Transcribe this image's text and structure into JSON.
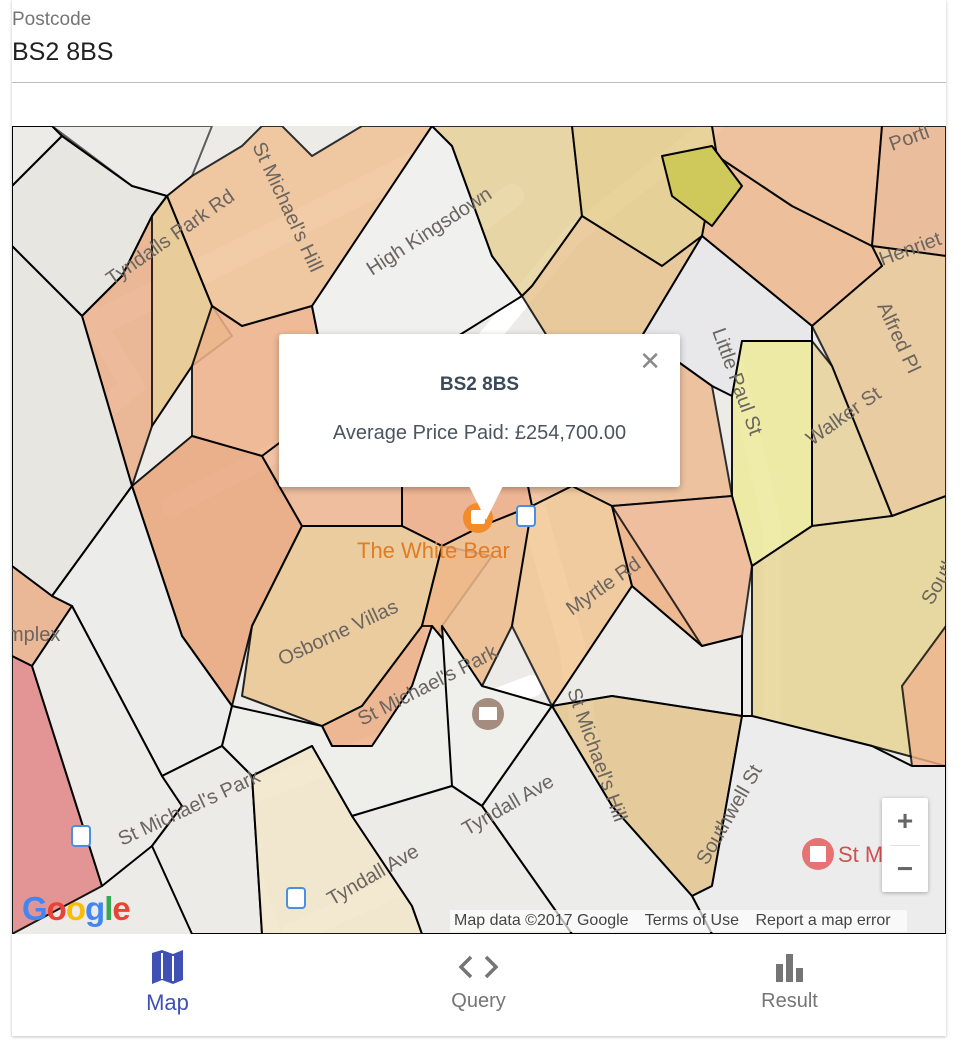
{
  "postcode_field": {
    "label": "Postcode",
    "value": "BS2 8BS"
  },
  "map": {
    "street_labels": [
      "Tyndalls Park Rd",
      "St Michael's Hill",
      "High Kingsdown",
      "Little Paul St",
      "Walker St",
      "Alfred Pl",
      "Portl",
      "Henriet",
      "Myrtle Rd",
      "Osborne Villas",
      "St Michael's Park",
      "St Michael's Park",
      "Tyndall Ave",
      "Tyndall Ave",
      "St Michael's Hill",
      "Southwell St",
      "South",
      "mplex"
    ],
    "poi_label": "The White Bear",
    "hospital_label": "St M",
    "popup": {
      "title": "BS2 8BS",
      "text": "Average Price Paid: £254,700.00",
      "close_icon": "close-icon"
    },
    "zoom_in_label": "+",
    "zoom_out_label": "−",
    "attribution": {
      "map_data": "Map data ©2017 Google",
      "terms": "Terms of Use",
      "report": "Report a map error"
    },
    "logo_text": "Google"
  },
  "bottom_nav": {
    "items": [
      {
        "label": "Map",
        "icon": "map-icon",
        "active": true
      },
      {
        "label": "Query",
        "icon": "code-icon",
        "active": false
      },
      {
        "label": "Result",
        "icon": "bar-chart-icon",
        "active": false
      }
    ]
  },
  "colors": {
    "accent": "#3f51b5",
    "inactive": "#757575"
  }
}
